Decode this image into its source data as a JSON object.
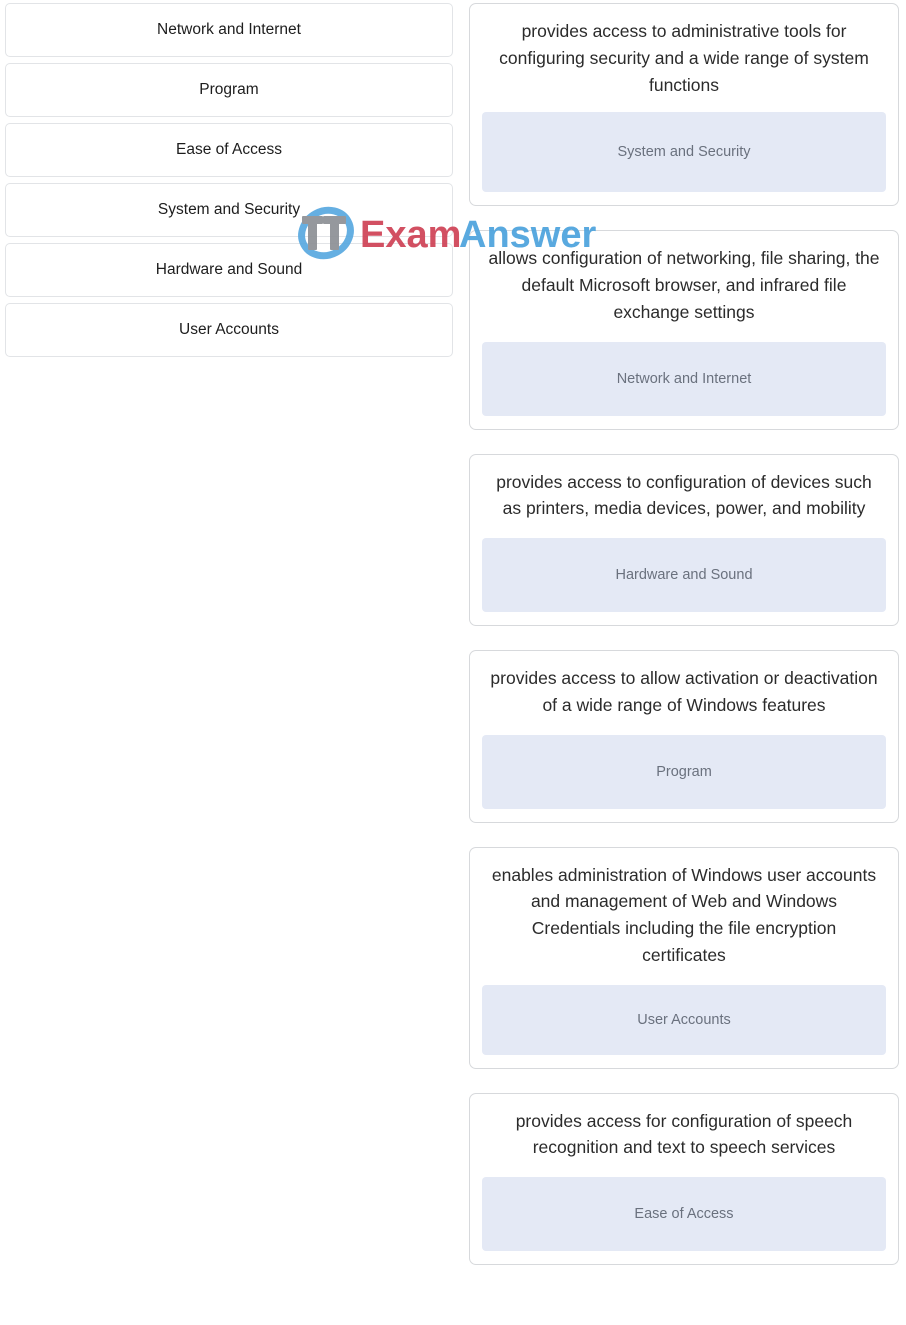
{
  "exercise": {
    "type": "drag-and-drop-matching",
    "instruction_visible": false
  },
  "source_list": {
    "name": "draggable-options",
    "items": [
      {
        "label": "Network and Internet"
      },
      {
        "label": "Program"
      },
      {
        "label": "Ease of Access"
      },
      {
        "label": "System and Security"
      },
      {
        "label": "Hardware and Sound"
      },
      {
        "label": "User Accounts"
      }
    ]
  },
  "target_cards": [
    {
      "prompt": "provides access to administrative tools for configuring security and a wide range of system functions",
      "answer": "System and Security"
    },
    {
      "prompt": "allows configuration of networking, file sharing, the default Microsoft browser, and infrared file exchange settings",
      "answer": "Network and Internet"
    },
    {
      "prompt": "provides access to configuration of devices such as printers, media devices, power, and mobility",
      "answer": "Hardware and Sound"
    },
    {
      "prompt": "provides access to allow activation or deactivation of a wide range of Windows features",
      "answer": "Program"
    },
    {
      "prompt": "enables administration of Windows user accounts and management of Web and Windows Credentials including the file encryption certificates",
      "answer": "User Accounts"
    },
    {
      "prompt": "provides access for configuration of speech recognition and text to speech services",
      "answer": "Ease of Access"
    }
  ],
  "watermark": {
    "text_it": "IT",
    "text_exam": "Exam",
    "text_answers": "Answers",
    "color_exam": "#cf4357",
    "color_answers": "#4da3dd",
    "color_it": "#8e9196",
    "color_swoosh": "#5aa9e0"
  },
  "colors": {
    "page_background": "#ffffff",
    "card_border": "#d7d9dc",
    "source_item_border": "#e2e4e7",
    "drop_slot_background": "#e4e9f5",
    "drop_slot_text": "#6a717e",
    "prompt_text": "#2b2b2b",
    "source_item_text": "#1d1d1d"
  }
}
